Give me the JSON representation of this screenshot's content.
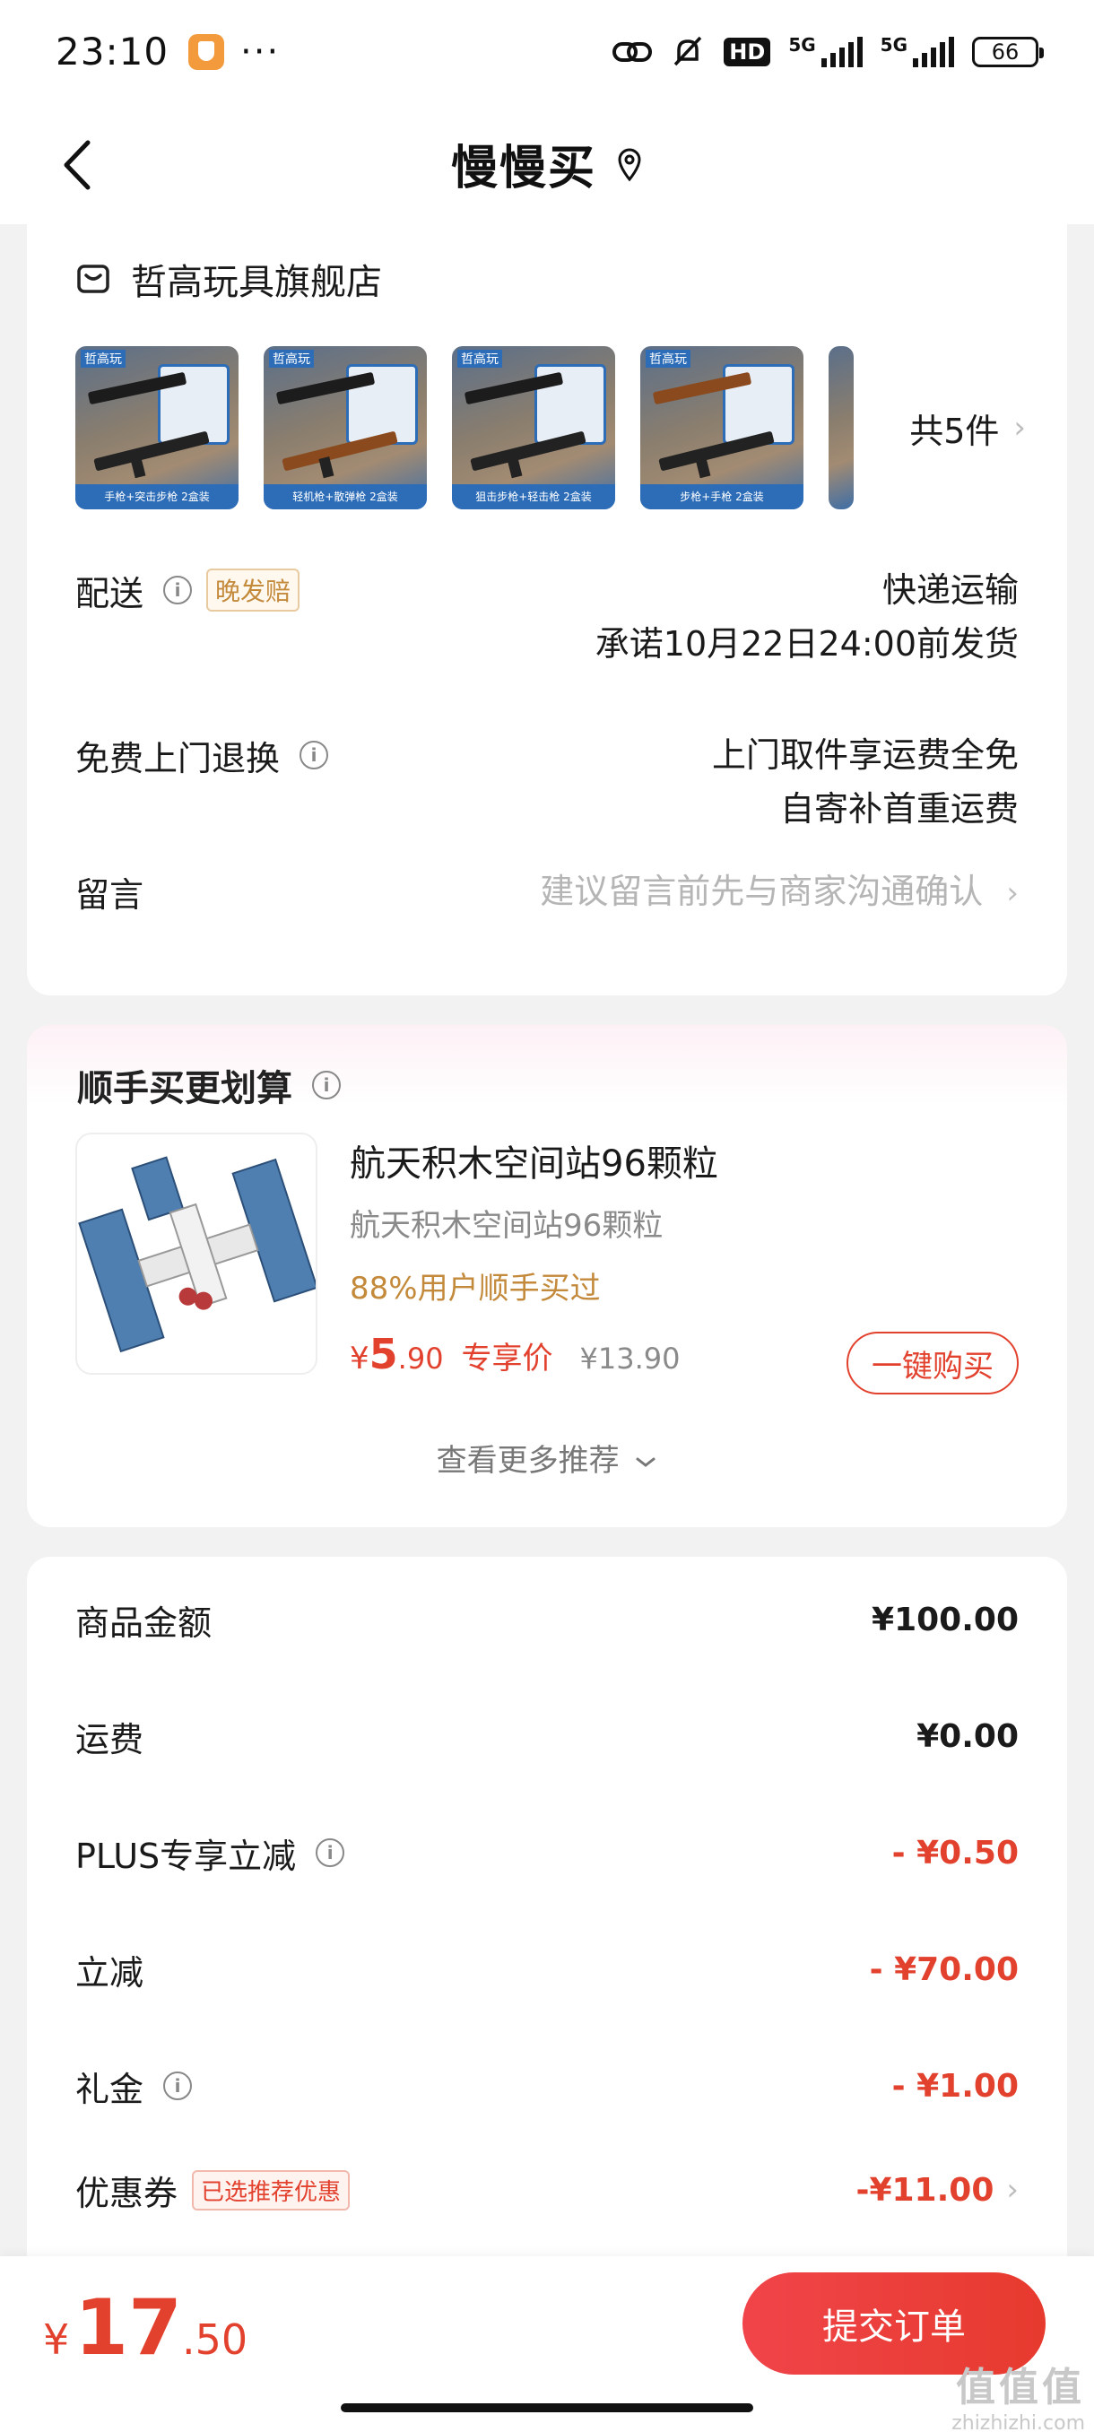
{
  "status_bar": {
    "time": "23:10",
    "dots": "···",
    "hd": "HD",
    "net1": "5G",
    "net2": "5G",
    "battery": "66"
  },
  "nav": {
    "title": "慢慢买"
  },
  "store": {
    "name": "哲高玩具旗舰店",
    "thumb_captions": [
      "手枪+突击步枪 2盒装",
      "轻机枪+散弹枪 2盒装",
      "狙击步枪+轻击枪 2盒装",
      "步枪+手枪 2盒装"
    ],
    "thumb_badge": "哲高玩",
    "count": "共5件"
  },
  "delivery": {
    "label": "配送",
    "tag": "晚发赔",
    "method": "快递运输",
    "promise": "承诺10月22日24:00前发货"
  },
  "returns": {
    "label": "免费上门退换",
    "line1": "上门取件享运费全免",
    "line2": "自寄补首重运费"
  },
  "message": {
    "label": "留言",
    "placeholder": "建议留言前先与商家沟通确认"
  },
  "upsell": {
    "header": "顺手买更划算",
    "title": "航天积木空间站96颗粒",
    "subtitle": "航天积木空间站96颗粒",
    "bought": "88%用户顺手买过",
    "price_currency": "¥",
    "price_int": "5",
    "price_dec": ".90",
    "exclusive": "专享价",
    "orig_price": "¥13.90",
    "buy_label": "一键购买",
    "more": "查看更多推荐"
  },
  "fees": [
    {
      "label": "商品金额",
      "value": "¥100.00",
      "info": false,
      "tag": "",
      "red": false
    },
    {
      "label": "运费",
      "value": "¥0.00",
      "info": false,
      "tag": "",
      "red": false
    },
    {
      "label": "PLUS专享立减",
      "value": "- ¥0.50",
      "info": true,
      "tag": "",
      "red": true
    },
    {
      "label": "立减",
      "value": "- ¥70.00",
      "info": false,
      "tag": "",
      "red": true
    },
    {
      "label": "礼金",
      "value": "- ¥1.00",
      "info": true,
      "tag": "",
      "red": true
    },
    {
      "label": "优惠券",
      "value": "-¥11.00",
      "info": false,
      "tag": "已选推荐优惠",
      "red": true
    }
  ],
  "bottom": {
    "currency": "¥",
    "total_int": "17",
    "total_dec": ".50",
    "submit": "提交订单"
  },
  "watermark": {
    "line1": "值值值",
    "line2": "zhizhizhi.com"
  },
  "colors": {
    "accent": "#e2412e",
    "gold": "#c48a3c",
    "background": "#f2f2f2"
  }
}
